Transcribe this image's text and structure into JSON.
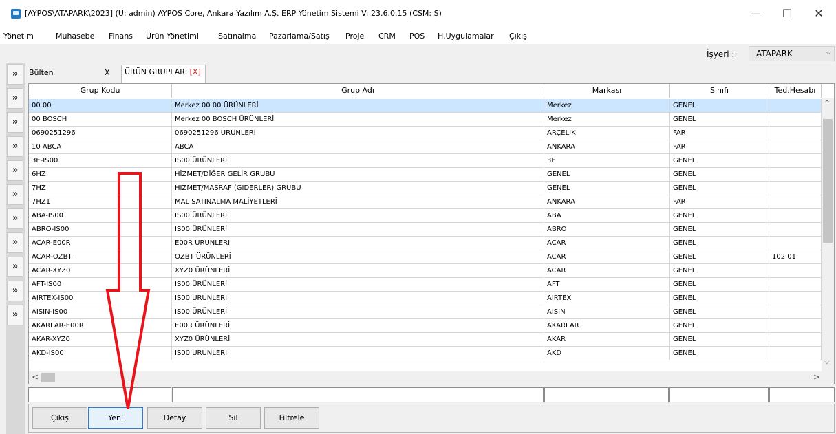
{
  "window": {
    "title": "[AYPOS\\ATAPARK\\2023] (U: admin) AYPOS Core, Ankara Yazılım A.Ş. ERP Yönetim Sistemi V: 23.6.0.15 (CSM: S)",
    "minimize": "—",
    "maximize": "☐",
    "close": "✕"
  },
  "menu": [
    "Yönetim",
    "Muhasebe",
    "Finans",
    "Ürün Yönetimi",
    "Satınalma",
    "Pazarlama/Satış",
    "Proje",
    "CRM",
    "POS",
    "H.Uygulamalar",
    "Çıkış"
  ],
  "isyeri": {
    "label": "İşyeri :",
    "value": "ATAPARK",
    "arrow": "⌵"
  },
  "sidebar": {
    "button_label": "»"
  },
  "tabs": {
    "bulten": "Bülten",
    "bulten_close": "X",
    "active": "ÜRÜN GRUPLARI",
    "active_close": "[X]"
  },
  "grid": {
    "columns": [
      "Grup Kodu",
      "Grup Adı",
      "Markası",
      "Sınıfı",
      "Ted.Hesabı"
    ],
    "rows": [
      [
        "00 00",
        "Merkez 00 00 ÜRÜNLERİ",
        "Merkez",
        "GENEL",
        ""
      ],
      [
        "00 BOSCH",
        "Merkez 00 BOSCH ÜRÜNLERİ",
        "Merkez",
        "GENEL",
        ""
      ],
      [
        "0690251296",
        "0690251296 ÜRÜNLERİ",
        "ARÇELİK",
        "FAR",
        ""
      ],
      [
        "10  ABCA",
        "ABCA",
        "ANKARA",
        "FAR",
        ""
      ],
      [
        "3E-IS00",
        "IS00 ÜRÜNLERİ",
        "3E",
        "GENEL",
        ""
      ],
      [
        "6HZ",
        "HİZMET/DİĞER GELİR GRUBU",
        "GENEL",
        "GENEL",
        ""
      ],
      [
        "7HZ",
        "HİZMET/MASRAF (GİDERLER) GRUBU",
        "GENEL",
        "GENEL",
        ""
      ],
      [
        "7HZ1",
        "MAL SATINALMA MALİYETLERİ",
        "ANKARA",
        "FAR",
        ""
      ],
      [
        "ABA-IS00",
        "IS00 ÜRÜNLERİ",
        "ABA",
        "GENEL",
        ""
      ],
      [
        "ABRO-IS00",
        "IS00 ÜRÜNLERİ",
        "ABRO",
        "GENEL",
        ""
      ],
      [
        "ACAR-E00R",
        "E00R ÜRÜNLERİ",
        "ACAR",
        "GENEL",
        ""
      ],
      [
        "ACAR-OZBT",
        "OZBT ÜRÜNLERİ",
        "ACAR",
        "GENEL",
        "102 01"
      ],
      [
        "ACAR-XYZ0",
        "XYZ0 ÜRÜNLERİ",
        "ACAR",
        "GENEL",
        ""
      ],
      [
        "AFT-IS00",
        "IS00 ÜRÜNLERİ",
        "AFT",
        "GENEL",
        ""
      ],
      [
        "AIRTEX-IS00",
        "IS00 ÜRÜNLERİ",
        "AIRTEX",
        "GENEL",
        ""
      ],
      [
        "AISIN-IS00",
        "IS00 ÜRÜNLERİ",
        "AISIN",
        "GENEL",
        ""
      ],
      [
        "AKARLAR-E00R",
        "E00R ÜRÜNLERİ",
        "AKARLAR",
        "GENEL",
        ""
      ],
      [
        "AKAR-XYZ0",
        "XYZ0 ÜRÜNLERİ",
        "AKAR",
        "GENEL",
        ""
      ],
      [
        "AKD-IS00",
        "IS00 ÜRÜNLERİ",
        "AKD",
        "GENEL",
        ""
      ]
    ],
    "selected_row": 0,
    "scroll_up": "^",
    "scroll_down": "⌵",
    "scroll_left": "<",
    "scroll_right": ">"
  },
  "buttons": {
    "cikis": "Çıkış",
    "yeni": "Yeni",
    "detay": "Detay",
    "sil": "Sil",
    "filtrele": "Filtrele"
  },
  "colors": {
    "selection": "#cce6ff",
    "annotation_arrow": "#e8141b",
    "tab_close": "#d02020"
  }
}
